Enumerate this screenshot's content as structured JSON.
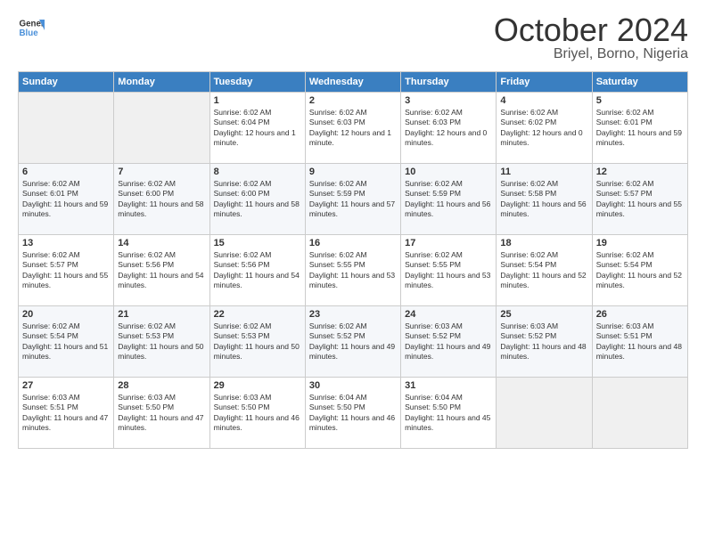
{
  "header": {
    "logo_line1": "General",
    "logo_line2": "Blue",
    "month": "October 2024",
    "location": "Briyel, Borno, Nigeria"
  },
  "days_of_week": [
    "Sunday",
    "Monday",
    "Tuesday",
    "Wednesday",
    "Thursday",
    "Friday",
    "Saturday"
  ],
  "weeks": [
    [
      {
        "day": "",
        "info": ""
      },
      {
        "day": "",
        "info": ""
      },
      {
        "day": "1",
        "info": "Sunrise: 6:02 AM\nSunset: 6:04 PM\nDaylight: 12 hours and 1 minute."
      },
      {
        "day": "2",
        "info": "Sunrise: 6:02 AM\nSunset: 6:03 PM\nDaylight: 12 hours and 1 minute."
      },
      {
        "day": "3",
        "info": "Sunrise: 6:02 AM\nSunset: 6:03 PM\nDaylight: 12 hours and 0 minutes."
      },
      {
        "day": "4",
        "info": "Sunrise: 6:02 AM\nSunset: 6:02 PM\nDaylight: 12 hours and 0 minutes."
      },
      {
        "day": "5",
        "info": "Sunrise: 6:02 AM\nSunset: 6:01 PM\nDaylight: 11 hours and 59 minutes."
      }
    ],
    [
      {
        "day": "6",
        "info": "Sunrise: 6:02 AM\nSunset: 6:01 PM\nDaylight: 11 hours and 59 minutes."
      },
      {
        "day": "7",
        "info": "Sunrise: 6:02 AM\nSunset: 6:00 PM\nDaylight: 11 hours and 58 minutes."
      },
      {
        "day": "8",
        "info": "Sunrise: 6:02 AM\nSunset: 6:00 PM\nDaylight: 11 hours and 58 minutes."
      },
      {
        "day": "9",
        "info": "Sunrise: 6:02 AM\nSunset: 5:59 PM\nDaylight: 11 hours and 57 minutes."
      },
      {
        "day": "10",
        "info": "Sunrise: 6:02 AM\nSunset: 5:59 PM\nDaylight: 11 hours and 56 minutes."
      },
      {
        "day": "11",
        "info": "Sunrise: 6:02 AM\nSunset: 5:58 PM\nDaylight: 11 hours and 56 minutes."
      },
      {
        "day": "12",
        "info": "Sunrise: 6:02 AM\nSunset: 5:57 PM\nDaylight: 11 hours and 55 minutes."
      }
    ],
    [
      {
        "day": "13",
        "info": "Sunrise: 6:02 AM\nSunset: 5:57 PM\nDaylight: 11 hours and 55 minutes."
      },
      {
        "day": "14",
        "info": "Sunrise: 6:02 AM\nSunset: 5:56 PM\nDaylight: 11 hours and 54 minutes."
      },
      {
        "day": "15",
        "info": "Sunrise: 6:02 AM\nSunset: 5:56 PM\nDaylight: 11 hours and 54 minutes."
      },
      {
        "day": "16",
        "info": "Sunrise: 6:02 AM\nSunset: 5:55 PM\nDaylight: 11 hours and 53 minutes."
      },
      {
        "day": "17",
        "info": "Sunrise: 6:02 AM\nSunset: 5:55 PM\nDaylight: 11 hours and 53 minutes."
      },
      {
        "day": "18",
        "info": "Sunrise: 6:02 AM\nSunset: 5:54 PM\nDaylight: 11 hours and 52 minutes."
      },
      {
        "day": "19",
        "info": "Sunrise: 6:02 AM\nSunset: 5:54 PM\nDaylight: 11 hours and 52 minutes."
      }
    ],
    [
      {
        "day": "20",
        "info": "Sunrise: 6:02 AM\nSunset: 5:54 PM\nDaylight: 11 hours and 51 minutes."
      },
      {
        "day": "21",
        "info": "Sunrise: 6:02 AM\nSunset: 5:53 PM\nDaylight: 11 hours and 50 minutes."
      },
      {
        "day": "22",
        "info": "Sunrise: 6:02 AM\nSunset: 5:53 PM\nDaylight: 11 hours and 50 minutes."
      },
      {
        "day": "23",
        "info": "Sunrise: 6:02 AM\nSunset: 5:52 PM\nDaylight: 11 hours and 49 minutes."
      },
      {
        "day": "24",
        "info": "Sunrise: 6:03 AM\nSunset: 5:52 PM\nDaylight: 11 hours and 49 minutes."
      },
      {
        "day": "25",
        "info": "Sunrise: 6:03 AM\nSunset: 5:52 PM\nDaylight: 11 hours and 48 minutes."
      },
      {
        "day": "26",
        "info": "Sunrise: 6:03 AM\nSunset: 5:51 PM\nDaylight: 11 hours and 48 minutes."
      }
    ],
    [
      {
        "day": "27",
        "info": "Sunrise: 6:03 AM\nSunset: 5:51 PM\nDaylight: 11 hours and 47 minutes."
      },
      {
        "day": "28",
        "info": "Sunrise: 6:03 AM\nSunset: 5:50 PM\nDaylight: 11 hours and 47 minutes."
      },
      {
        "day": "29",
        "info": "Sunrise: 6:03 AM\nSunset: 5:50 PM\nDaylight: 11 hours and 46 minutes."
      },
      {
        "day": "30",
        "info": "Sunrise: 6:04 AM\nSunset: 5:50 PM\nDaylight: 11 hours and 46 minutes."
      },
      {
        "day": "31",
        "info": "Sunrise: 6:04 AM\nSunset: 5:50 PM\nDaylight: 11 hours and 45 minutes."
      },
      {
        "day": "",
        "info": ""
      },
      {
        "day": "",
        "info": ""
      }
    ]
  ]
}
